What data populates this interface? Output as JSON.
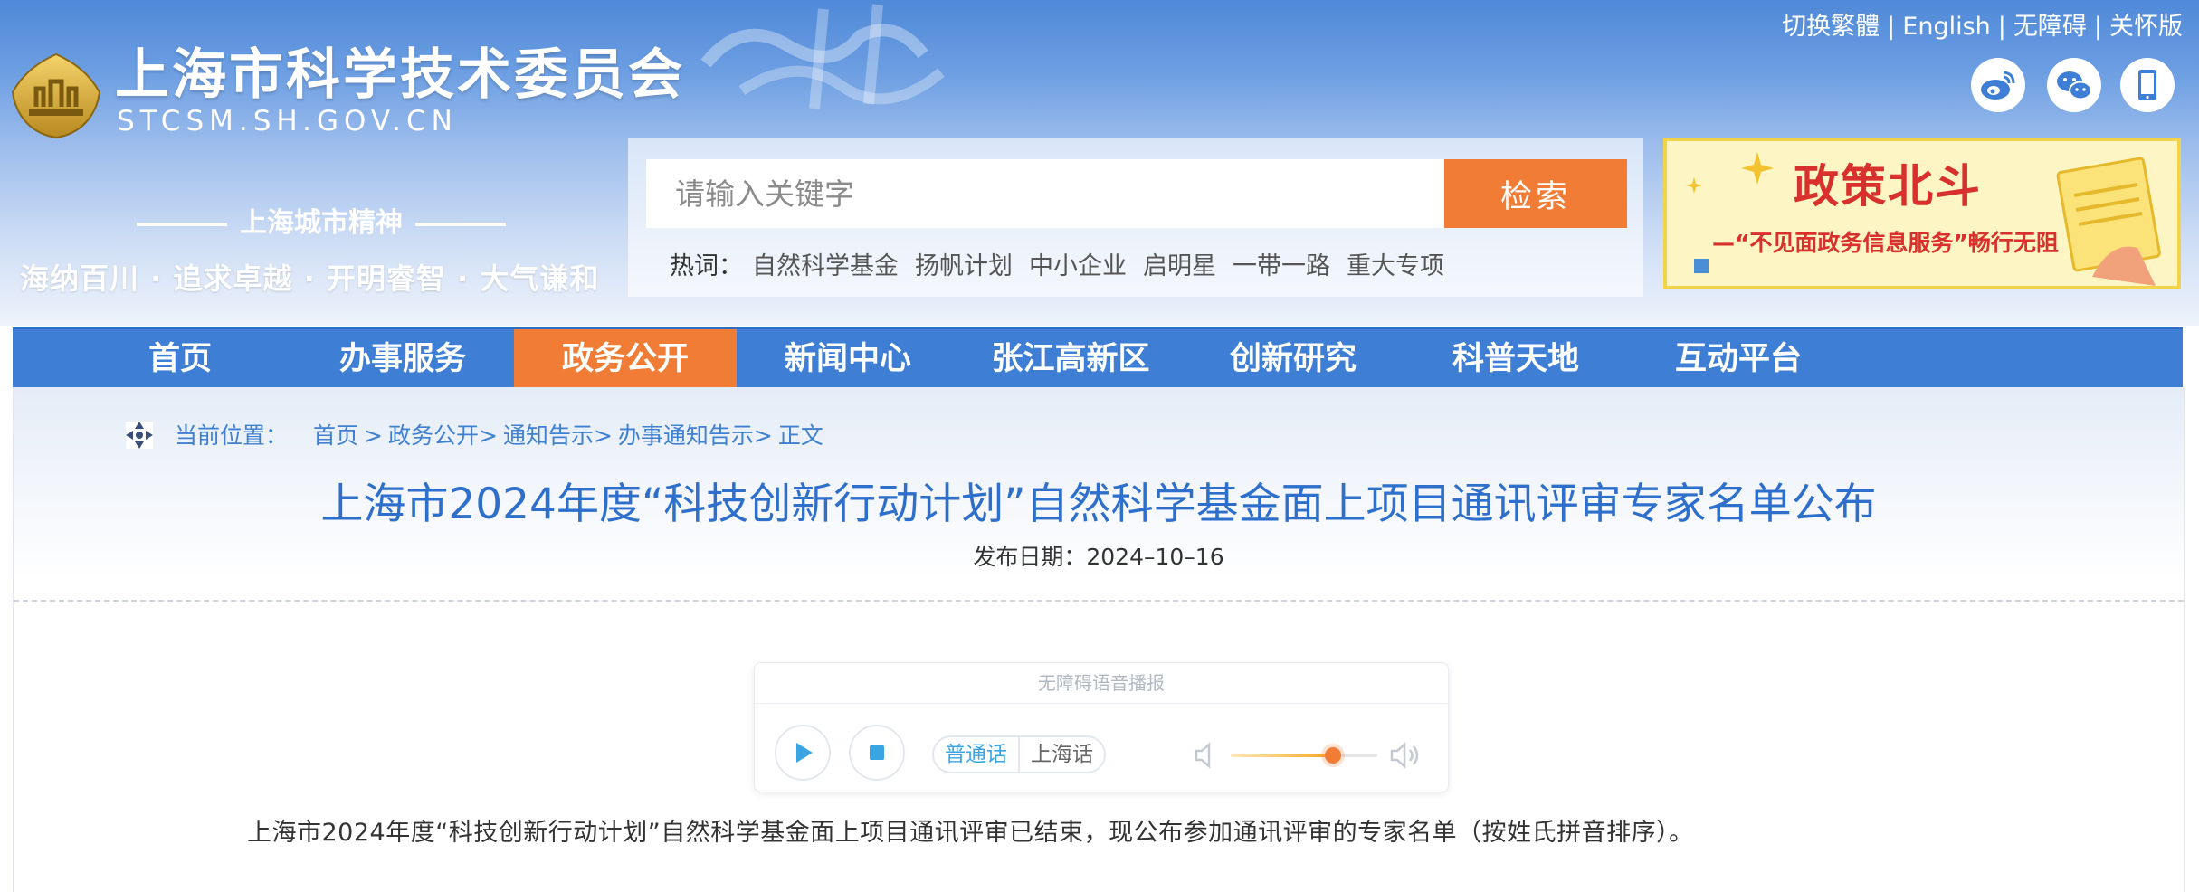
{
  "site": {
    "name": "上海市科学技术委员会",
    "domain": "STCSM.SH.GOV.CN",
    "spirit_title": "上海城市精神",
    "spirit_motto": "海纳百川 · 追求卓越 · 开明睿智 · 大气谦和"
  },
  "top_links": [
    "切换繁體",
    "English",
    "无障碍",
    "关怀版"
  ],
  "social": [
    "weibo-icon",
    "wechat-icon",
    "mobile-icon"
  ],
  "search": {
    "placeholder": "请输入关键字",
    "value": "",
    "button_label": "检索",
    "hot_label": "热词：",
    "hot_words": [
      "自然科学基金",
      "扬帆计划",
      "中小企业",
      "启明星",
      "一带一路",
      "重大专项"
    ]
  },
  "banner": {
    "title": "政策北斗",
    "subtitle": "—“不见面政务信息服务”畅行无阻"
  },
  "nav": {
    "items": [
      "首页",
      "办事服务",
      "政务公开",
      "新闻中心",
      "张江高新区",
      "创新研究",
      "科普天地",
      "互动平台"
    ],
    "active_index": 2
  },
  "breadcrumb": {
    "label": "当前位置：",
    "items": [
      "首页",
      ">",
      "政务公开>",
      "通知告示>",
      "办事通知告示>",
      "正文"
    ]
  },
  "article": {
    "title": "上海市2024年度“科技创新行动计划”自然科学基金面上项目通讯评审专家名单公布",
    "date_label": "发布日期：",
    "date": "2024–10–16",
    "intro": "上海市2024年度“科技创新行动计划”自然科学基金面上项目通讯评审已结束，现公布参加通讯评审的专家名单（按姓氏拼音排序）。"
  },
  "audio": {
    "title": "无障碍语音播报",
    "dialects": [
      "普通话",
      "上海话"
    ],
    "selected_dialect": "普通话",
    "volume": 0.7
  },
  "colors": {
    "nav_blue": "#3e7fd5",
    "accent_orange": "#f07c35",
    "title_blue": "#2d6fca",
    "link_blue": "#3f80d0"
  }
}
